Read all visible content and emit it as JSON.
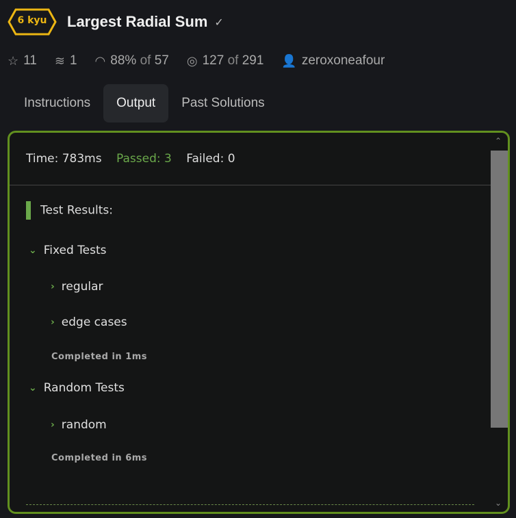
{
  "kata": {
    "rank": "6 kyu",
    "title": "Largest Radial Sum"
  },
  "stats": {
    "stars": "11",
    "collections": "1",
    "satisfaction": "88%",
    "satisfaction_of": "of",
    "satisfaction_votes": "57",
    "completed": "127",
    "completed_of": "of",
    "completed_total": "291",
    "author": "zeroxoneafour"
  },
  "tabs": [
    {
      "label": "Instructions"
    },
    {
      "label": "Output"
    },
    {
      "label": "Past Solutions"
    }
  ],
  "output": {
    "time": "Time: 783ms",
    "passed": "Passed: 3",
    "failed": "Failed: 0",
    "heading": "Test Results:",
    "groups": [
      {
        "name": "Fixed Tests",
        "items": [
          "regular",
          "edge cases"
        ],
        "completed": "Completed in 1ms"
      },
      {
        "name": "Random Tests",
        "items": [
          "random"
        ],
        "completed": "Completed in 6ms"
      }
    ]
  },
  "colors": {
    "accent": "#6aa84a",
    "rank": "#ecb613",
    "border": "#62901f"
  }
}
